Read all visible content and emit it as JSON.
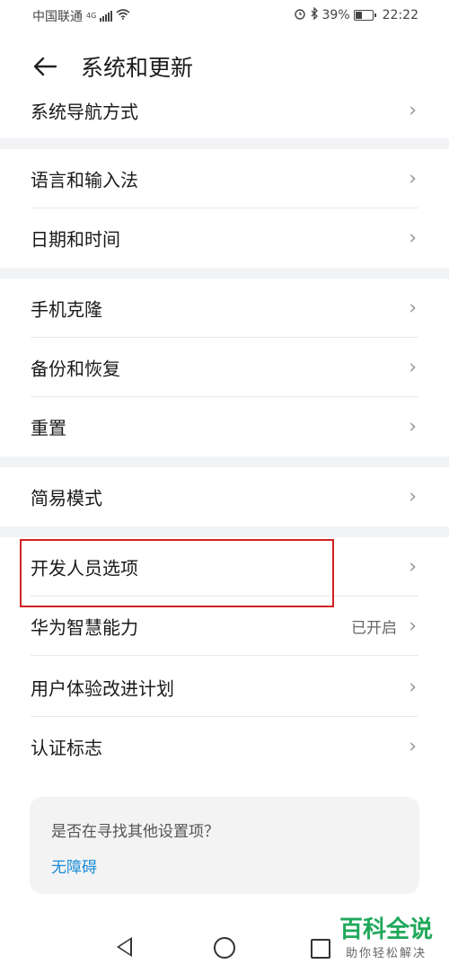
{
  "status_bar": {
    "carrier": "中国联通",
    "network": "4G",
    "battery": "39%",
    "battery_level": 0.39,
    "time": "22:22",
    "icons": [
      "signal-icon",
      "wifi-icon",
      "alarm-icon",
      "bluetooth-icon",
      "battery-icon"
    ]
  },
  "header": {
    "title": "系统和更新",
    "back_icon": "back-arrow-icon"
  },
  "groups": [
    [
      {
        "label": "系统导航方式"
      }
    ],
    [
      {
        "label": "语言和输入法"
      },
      {
        "label": "日期和时间"
      }
    ],
    [
      {
        "label": "手机克隆"
      },
      {
        "label": "备份和恢复"
      },
      {
        "label": "重置"
      }
    ],
    [
      {
        "label": "简易模式"
      }
    ],
    [
      {
        "label": "开发人员选项"
      },
      {
        "label": "华为智慧能力",
        "status": "已开启"
      },
      {
        "label": "用户体验改进计划"
      },
      {
        "label": "认证标志"
      }
    ]
  ],
  "card": {
    "question": "是否在寻找其他设置项？",
    "link": "无障碍"
  },
  "nav": {
    "icons": [
      "back-nav-icon",
      "home-nav-icon",
      "recents-nav-icon"
    ]
  },
  "watermark": {
    "title": "百科全说",
    "subtitle": "助你轻松解决"
  },
  "colors": {
    "accent": "#1a8cd8",
    "highlight": "#d12020",
    "watermark": "#1fa85a"
  }
}
